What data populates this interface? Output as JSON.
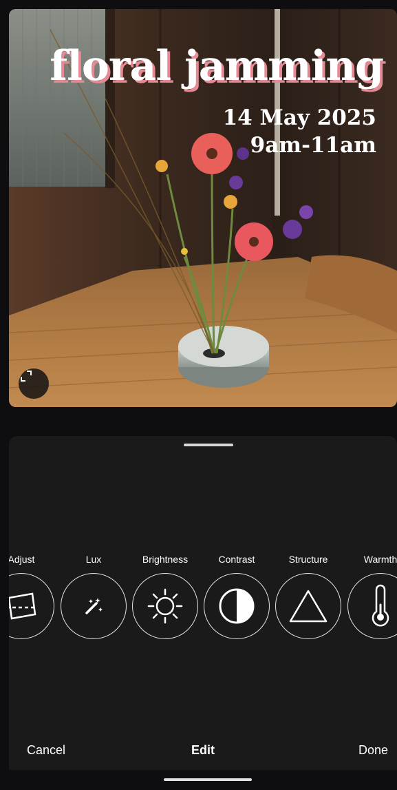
{
  "photo": {
    "overlay_title": "floral jamming",
    "overlay_date": "14 May 2025",
    "overlay_time": "9am-11am",
    "expand_icon": "expand-icon"
  },
  "tools": [
    {
      "label": "Adjust",
      "icon": "adjust-icon"
    },
    {
      "label": "Lux",
      "icon": "magic-wand-icon"
    },
    {
      "label": "Brightness",
      "icon": "sun-icon"
    },
    {
      "label": "Contrast",
      "icon": "contrast-icon"
    },
    {
      "label": "Structure",
      "icon": "triangle-icon"
    },
    {
      "label": "Warmth",
      "icon": "thermometer-icon"
    }
  ],
  "footer": {
    "cancel_label": "Cancel",
    "title": "Edit",
    "done_label": "Done"
  },
  "colors": {
    "sheet_bg": "#1a1a1a",
    "title_shadow": "#e58a95",
    "text": "#ffffff"
  }
}
